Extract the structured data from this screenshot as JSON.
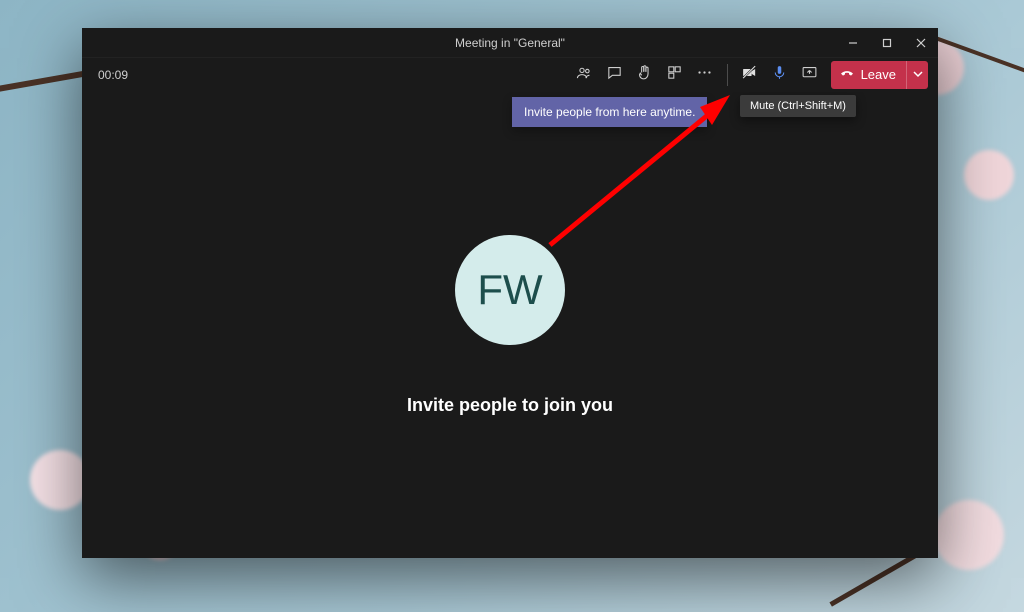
{
  "titlebar": {
    "title": "Meeting in \"General\""
  },
  "toolbar": {
    "timer": "00:09",
    "leave_label": "Leave"
  },
  "tips": {
    "invite": "Invite people from here anytime.",
    "mute": "Mute (Ctrl+Shift+M)"
  },
  "avatar": {
    "initials": "FW"
  },
  "stage": {
    "invite_heading": "Invite people to join you"
  }
}
